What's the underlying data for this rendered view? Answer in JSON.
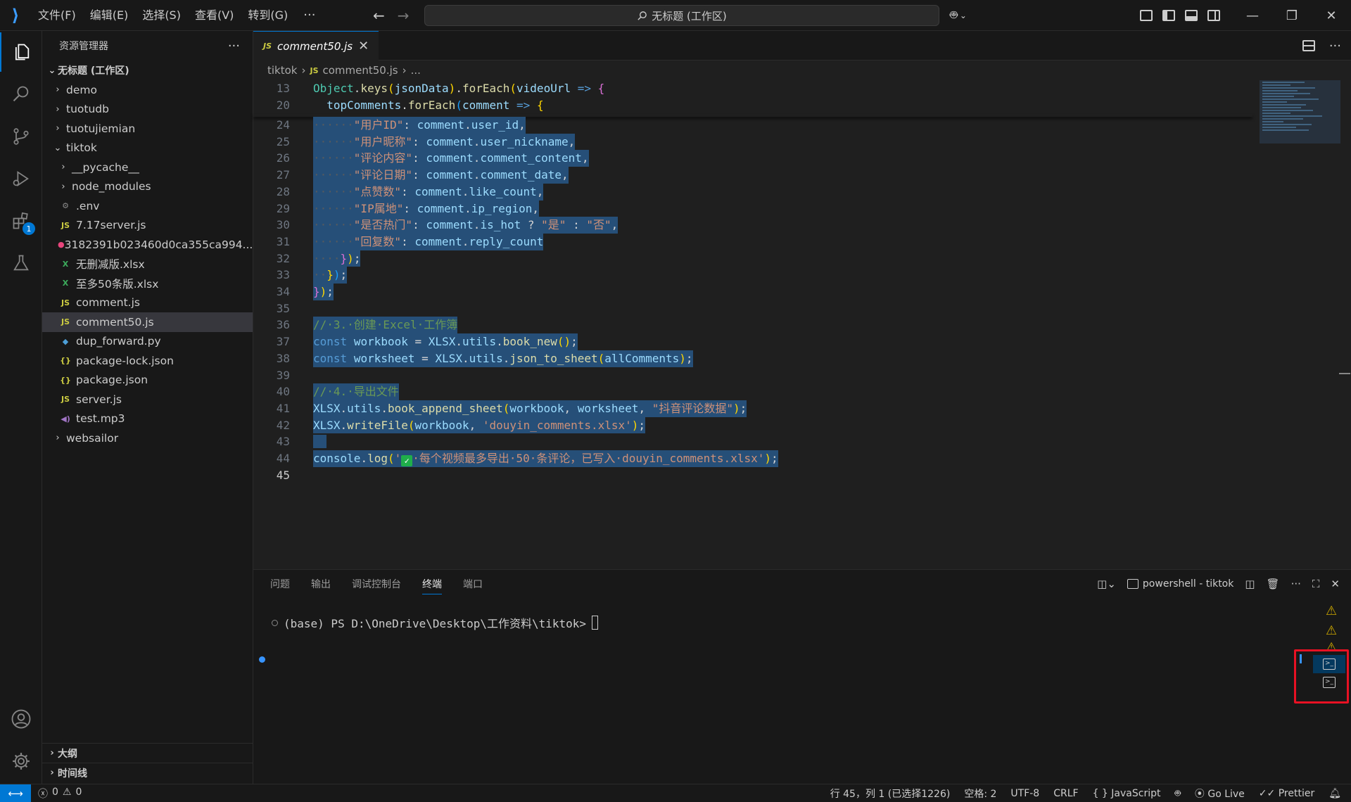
{
  "titlebar": {
    "menus": [
      "文件(F)",
      "编辑(E)",
      "选择(S)",
      "查看(V)",
      "转到(G)"
    ],
    "more": "···",
    "search_text": "无标题 (工作区)",
    "back_icon": "arrow-left-icon",
    "forward_icon": "arrow-right-icon"
  },
  "sidebar": {
    "title": "资源管理器",
    "more": "···",
    "workspace": "无标题 (工作区)",
    "items": [
      {
        "label": "demo",
        "kind": "folder",
        "indent": 1
      },
      {
        "label": "tuotudb",
        "kind": "folder",
        "indent": 1
      },
      {
        "label": "tuotujiemian",
        "kind": "folder",
        "indent": 1
      },
      {
        "label": "tiktok",
        "kind": "folder-open",
        "indent": 1
      },
      {
        "label": "__pycache__",
        "kind": "folder",
        "indent": 2
      },
      {
        "label": "node_modules",
        "kind": "folder",
        "indent": 2
      },
      {
        "label": ".env",
        "kind": "env",
        "indent": 2
      },
      {
        "label": "7.17server.js",
        "kind": "js",
        "indent": 2
      },
      {
        "label": "3182391b023460d0ca355ca994...",
        "kind": "media",
        "indent": 2
      },
      {
        "label": "无删减版.xlsx",
        "kind": "xlsx",
        "indent": 2
      },
      {
        "label": "至多50条版.xlsx",
        "kind": "xlsx",
        "indent": 2
      },
      {
        "label": "comment.js",
        "kind": "js",
        "indent": 2
      },
      {
        "label": "comment50.js",
        "kind": "js",
        "indent": 2,
        "selected": true
      },
      {
        "label": "dup_forward.py",
        "kind": "py",
        "indent": 2
      },
      {
        "label": "package-lock.json",
        "kind": "json",
        "indent": 2
      },
      {
        "label": "package.json",
        "kind": "json",
        "indent": 2
      },
      {
        "label": "server.js",
        "kind": "js",
        "indent": 2
      },
      {
        "label": "test.mp3",
        "kind": "mp3",
        "indent": 2
      },
      {
        "label": "websailor",
        "kind": "folder",
        "indent": 1
      }
    ],
    "outline": "大纲",
    "timeline": "时间线"
  },
  "editor": {
    "tab": {
      "icon": "JS",
      "label": "comment50.js"
    },
    "breadcrumb": {
      "folder": "tiktok",
      "icon": "JS",
      "file": "comment50.js",
      "rest": "..."
    }
  },
  "panel": {
    "tabs": [
      "问题",
      "输出",
      "调试控制台",
      "终端",
      "端口"
    ],
    "active_tab": "终端",
    "terminal_label": "powershell - tiktok",
    "prompt": "(base) PS D:\\OneDrive\\Desktop\\工作资料\\tiktok>"
  },
  "statusbar": {
    "errors": "0",
    "warnings": "0",
    "position": "行 45，列 1 (已选择1226)",
    "spaces": "空格: 2",
    "encoding": "UTF-8",
    "eol": "CRLF",
    "language": "{ } JavaScript",
    "golive": "Go Live",
    "prettier": "Prettier"
  },
  "colors": {
    "accent": "#0078d4",
    "selection": "#264f78",
    "highlight_box": "#e81123"
  }
}
